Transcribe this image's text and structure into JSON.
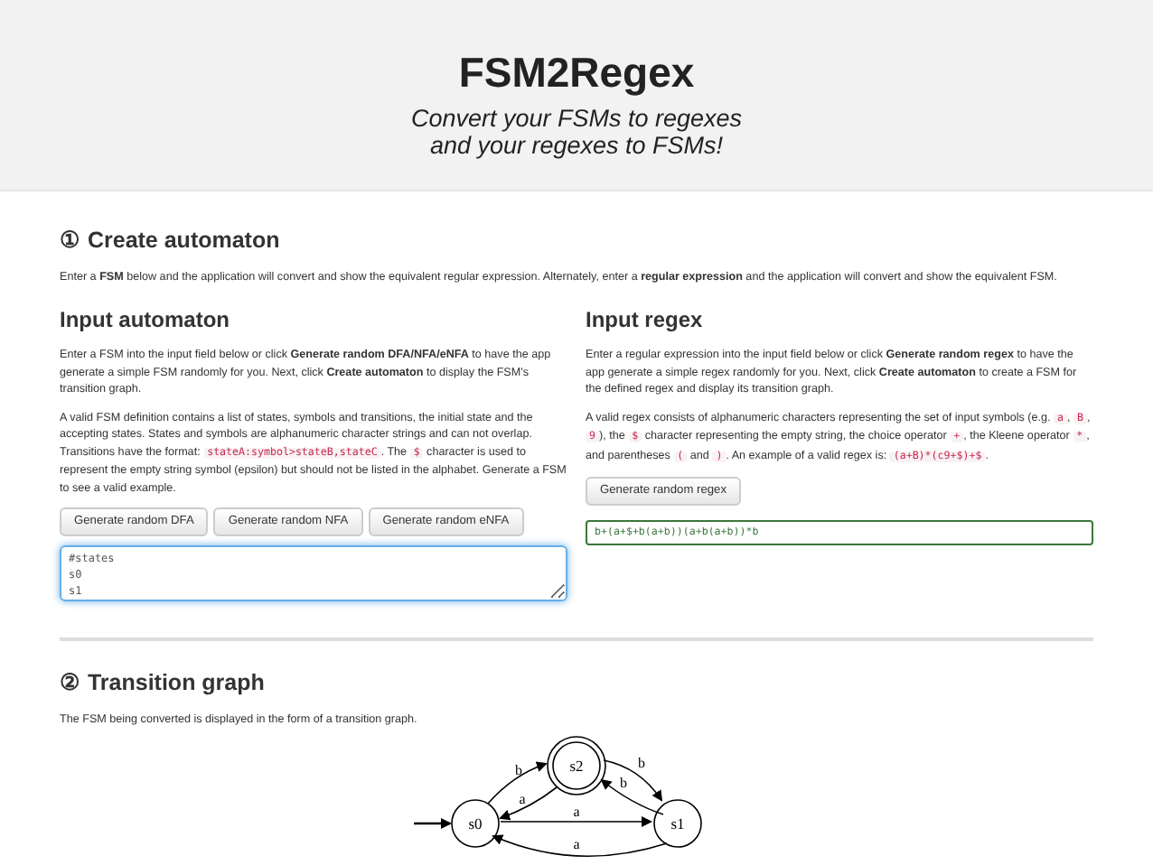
{
  "header": {
    "title": "FSM2Regex",
    "subtitle": [
      "Convert your FSMs to regexes",
      "and your regexes to FSMs!"
    ]
  },
  "create_section": {
    "title": "① Create automaton",
    "intro": "Enter a **FSM** below and the application will convert and show the equivalent regular expression. Alternately, enter a **regular expression** and the application will convert and show the equivalent FSM."
  },
  "input_automaton": {
    "title": "Input automaton",
    "paragraphs": [
      [
        {
          "kind": "text",
          "text": "Enter a FSM into the input field below or click **Generate random DFA/NFA/eNFA** to have the app generate a simple FSM randomly for you. Next, click **Create automaton** to display the FSM's transition graph."
        }
      ],
      [
        {
          "kind": "text",
          "text": "A valid FSM definition contains a list of states, symbols and transitions, the initial state and the accepting states. States and symbols are alphanumeric character strings and can not overlap. Transitions have the format: "
        },
        {
          "kind": "code",
          "text": "stateA:symbol>stateB,stateC"
        },
        {
          "kind": "text",
          "text": ". The "
        },
        {
          "kind": "code",
          "text": "$"
        },
        {
          "kind": "text",
          "text": " character is used to represent the empty string symbol (epsilon) but should not be listed in the alphabet. Generate a FSM to see a valid example."
        }
      ]
    ],
    "buttons": [
      "Generate random DFA",
      "Generate random NFA",
      "Generate random eNFA"
    ],
    "field": {
      "value": "#states\ns0\ns1",
      "focused": true
    }
  },
  "input_regex": {
    "title": "Input regex",
    "paragraphs": [
      [
        {
          "kind": "text",
          "text": "Enter a regular expression into the input field below or click **Generate random regex** to have the app generate a simple regex randomly for you. Next, click **Create automaton** to create a FSM for the defined regex and display its transition graph."
        }
      ],
      [
        {
          "kind": "text",
          "text": "A valid regex consists of alphanumeric characters representing the set of input symbols (e.g. "
        },
        {
          "kind": "code",
          "text": "a"
        },
        {
          "kind": "text",
          "text": ", "
        },
        {
          "kind": "code",
          "text": "B"
        },
        {
          "kind": "text",
          "text": ", "
        },
        {
          "kind": "code",
          "text": "9"
        },
        {
          "kind": "text",
          "text": "), the "
        },
        {
          "kind": "code",
          "text": "$"
        },
        {
          "kind": "text",
          "text": " character representing the empty string, the choice operator "
        },
        {
          "kind": "code",
          "text": "+"
        },
        {
          "kind": "text",
          "text": ", the Kleene operator "
        },
        {
          "kind": "code",
          "text": "*"
        },
        {
          "kind": "text",
          "text": ", and parentheses "
        },
        {
          "kind": "code",
          "text": "("
        },
        {
          "kind": "text",
          "text": " and "
        },
        {
          "kind": "code",
          "text": ")"
        },
        {
          "kind": "text",
          "text": ". An example of a valid regex is: "
        },
        {
          "kind": "code",
          "text": "(a+B)*(c9+$)+$"
        },
        {
          "kind": "text",
          "text": "."
        }
      ]
    ],
    "buttons": [
      "Generate random regex"
    ],
    "field": {
      "value": "b+(a+$+b(a+b))(a+b(a+b))*b",
      "valid": true
    }
  },
  "graph_section": {
    "title": "② Transition graph",
    "intro": "The FSM being converted is displayed in the form of a transition graph.",
    "nodes": [
      {
        "name": "s0",
        "accepting": false,
        "initial": true
      },
      {
        "name": "s2",
        "accepting": true,
        "initial": false
      },
      {
        "name": "s1",
        "accepting": false,
        "initial": false
      }
    ],
    "edges": [
      {
        "label": "b"
      },
      {
        "label": "a"
      },
      {
        "label": "b"
      },
      {
        "label": "b"
      },
      {
        "label": "a"
      },
      {
        "label": "a"
      }
    ]
  }
}
